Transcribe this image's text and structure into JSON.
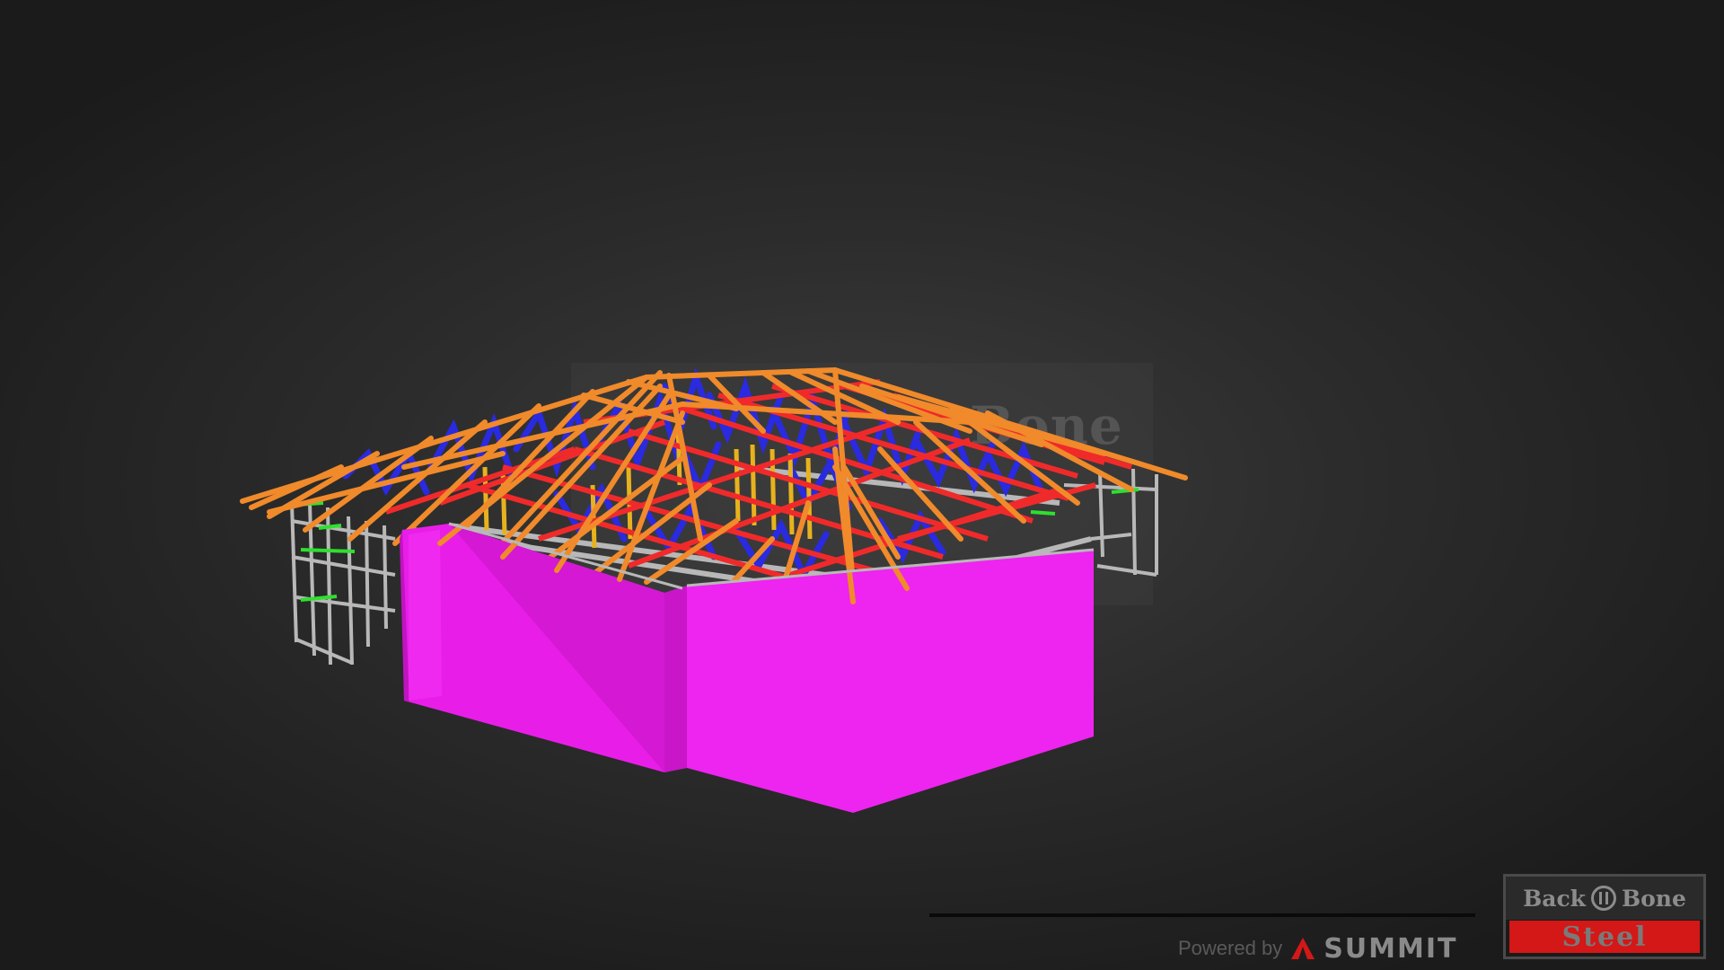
{
  "viewer": {
    "watermark_text": "Bone",
    "powered_by_label": "Powered by",
    "summit_label": "SUMMIT"
  },
  "logo": {
    "word_left": "Back",
    "word_right": "Bone",
    "word_bottom": "Steel",
    "accent_color": "#d41717"
  },
  "model": {
    "wall_color": "#f31ff5",
    "rafter_color": "#f08a2a",
    "truss_web_color": "#2a2ae0",
    "chord_color": "#f02a2a",
    "frame_color": "#b8b8b8",
    "brace_color": "#2ee02e",
    "stud_color": "#e8b21e"
  }
}
